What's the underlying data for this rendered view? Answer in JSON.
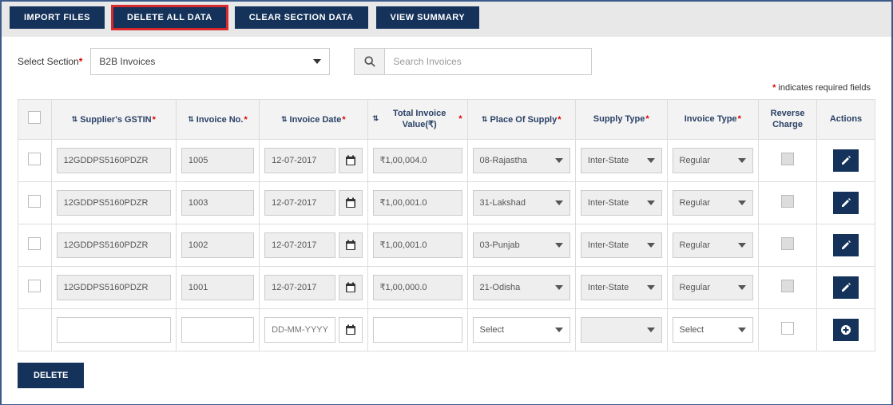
{
  "topButtons": {
    "import": "IMPORT FILES",
    "deleteAll": "DELETE ALL DATA",
    "clearSection": "CLEAR SECTION DATA",
    "viewSummary": "VIEW SUMMARY"
  },
  "sectionLabel": "Select Section",
  "sectionValue": "B2B Invoices",
  "searchPlaceholder": "Search Invoices",
  "indicatorText": " indicates required fields",
  "headers": {
    "gstin": "Supplier's GSTIN",
    "invno": "Invoice No.",
    "invdate": "Invoice Date",
    "total": "Total Invoice Value(₹)",
    "pos": "Place Of Supply",
    "supply": "Supply Type",
    "invtype": "Invoice Type",
    "reverse": "Reverse Charge",
    "actions": "Actions"
  },
  "rows": [
    {
      "gstin": "12GDDPS5160PDZR",
      "invno": "1005",
      "date": "12-07-2017",
      "total": "₹1,00,004.0",
      "pos": "08-Rajastha",
      "supply": "Inter-State",
      "invtype": "Regular"
    },
    {
      "gstin": "12GDDPS5160PDZR",
      "invno": "1003",
      "date": "12-07-2017",
      "total": "₹1,00,001.0",
      "pos": "31-Lakshad",
      "supply": "Inter-State",
      "invtype": "Regular"
    },
    {
      "gstin": "12GDDPS5160PDZR",
      "invno": "1002",
      "date": "12-07-2017",
      "total": "₹1,00,001.0",
      "pos": "03-Punjab",
      "supply": "Inter-State",
      "invtype": "Regular"
    },
    {
      "gstin": "12GDDPS5160PDZR",
      "invno": "1001",
      "date": "12-07-2017",
      "total": "₹1,00,000.0",
      "pos": "21-Odisha",
      "supply": "Inter-State",
      "invtype": "Regular"
    }
  ],
  "newRow": {
    "datePlaceholder": "DD-MM-YYYY",
    "selectLabel": "Select"
  },
  "deleteLabel": "DELETE"
}
